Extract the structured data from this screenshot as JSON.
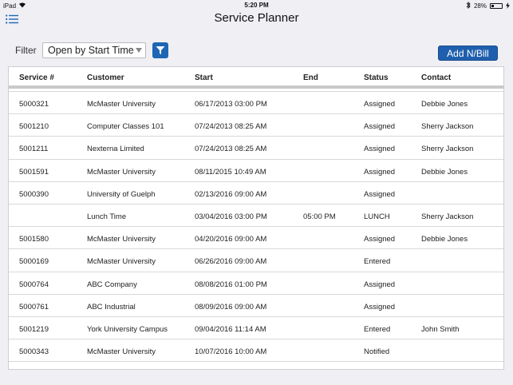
{
  "status_bar": {
    "device": "iPad",
    "time": "5:20 PM",
    "battery": "28%",
    "battery_level": 0.28
  },
  "nav": {
    "title": "Service Planner"
  },
  "filter": {
    "label": "Filter",
    "selected": "Open by Start Time"
  },
  "add_button": "Add N/Bill",
  "table": {
    "headers": [
      "Service #",
      "Customer",
      "Start",
      "End",
      "Status",
      "Contact"
    ],
    "rows": [
      [
        "5000321",
        "McMaster University",
        "06/17/2013 03:00 PM",
        "",
        "Assigned",
        "Debbie Jones"
      ],
      [
        "5001210",
        "Computer Classes 101",
        "07/24/2013 08:25 AM",
        "",
        "Assigned",
        "Sherry Jackson"
      ],
      [
        "5001211",
        "Nexterna Limited",
        "07/24/2013 08:25 AM",
        "",
        "Assigned",
        "Sherry Jackson"
      ],
      [
        "5001591",
        "McMaster University",
        "08/11/2015 10:49 AM",
        "",
        "Assigned",
        "Debbie Jones"
      ],
      [
        "5000390",
        "University of Guelph",
        "02/13/2016 09:00 AM",
        "",
        "Assigned",
        ""
      ],
      [
        "",
        "Lunch Time",
        "03/04/2016 03:00 PM",
        "05:00 PM",
        "LUNCH",
        "Sherry Jackson"
      ],
      [
        "5001580",
        "McMaster University",
        "04/20/2016 09:00 AM",
        "",
        "Assigned",
        "Debbie Jones"
      ],
      [
        "5000169",
        "McMaster University",
        "06/26/2016 09:00 AM",
        "",
        "Entered",
        ""
      ],
      [
        "5000764",
        "ABC Company",
        "08/08/2016 01:00 PM",
        "",
        "Assigned",
        ""
      ],
      [
        "5000761",
        "ABC Industrial",
        "08/09/2016 09:00 AM",
        "",
        "Assigned",
        ""
      ],
      [
        "5001219",
        "York University Campus",
        "09/04/2016 11:14 AM",
        "",
        "Entered",
        "John Smith"
      ],
      [
        "5000343",
        "McMaster University",
        "10/07/2016 10:00 AM",
        "",
        "Notified",
        ""
      ]
    ]
  }
}
